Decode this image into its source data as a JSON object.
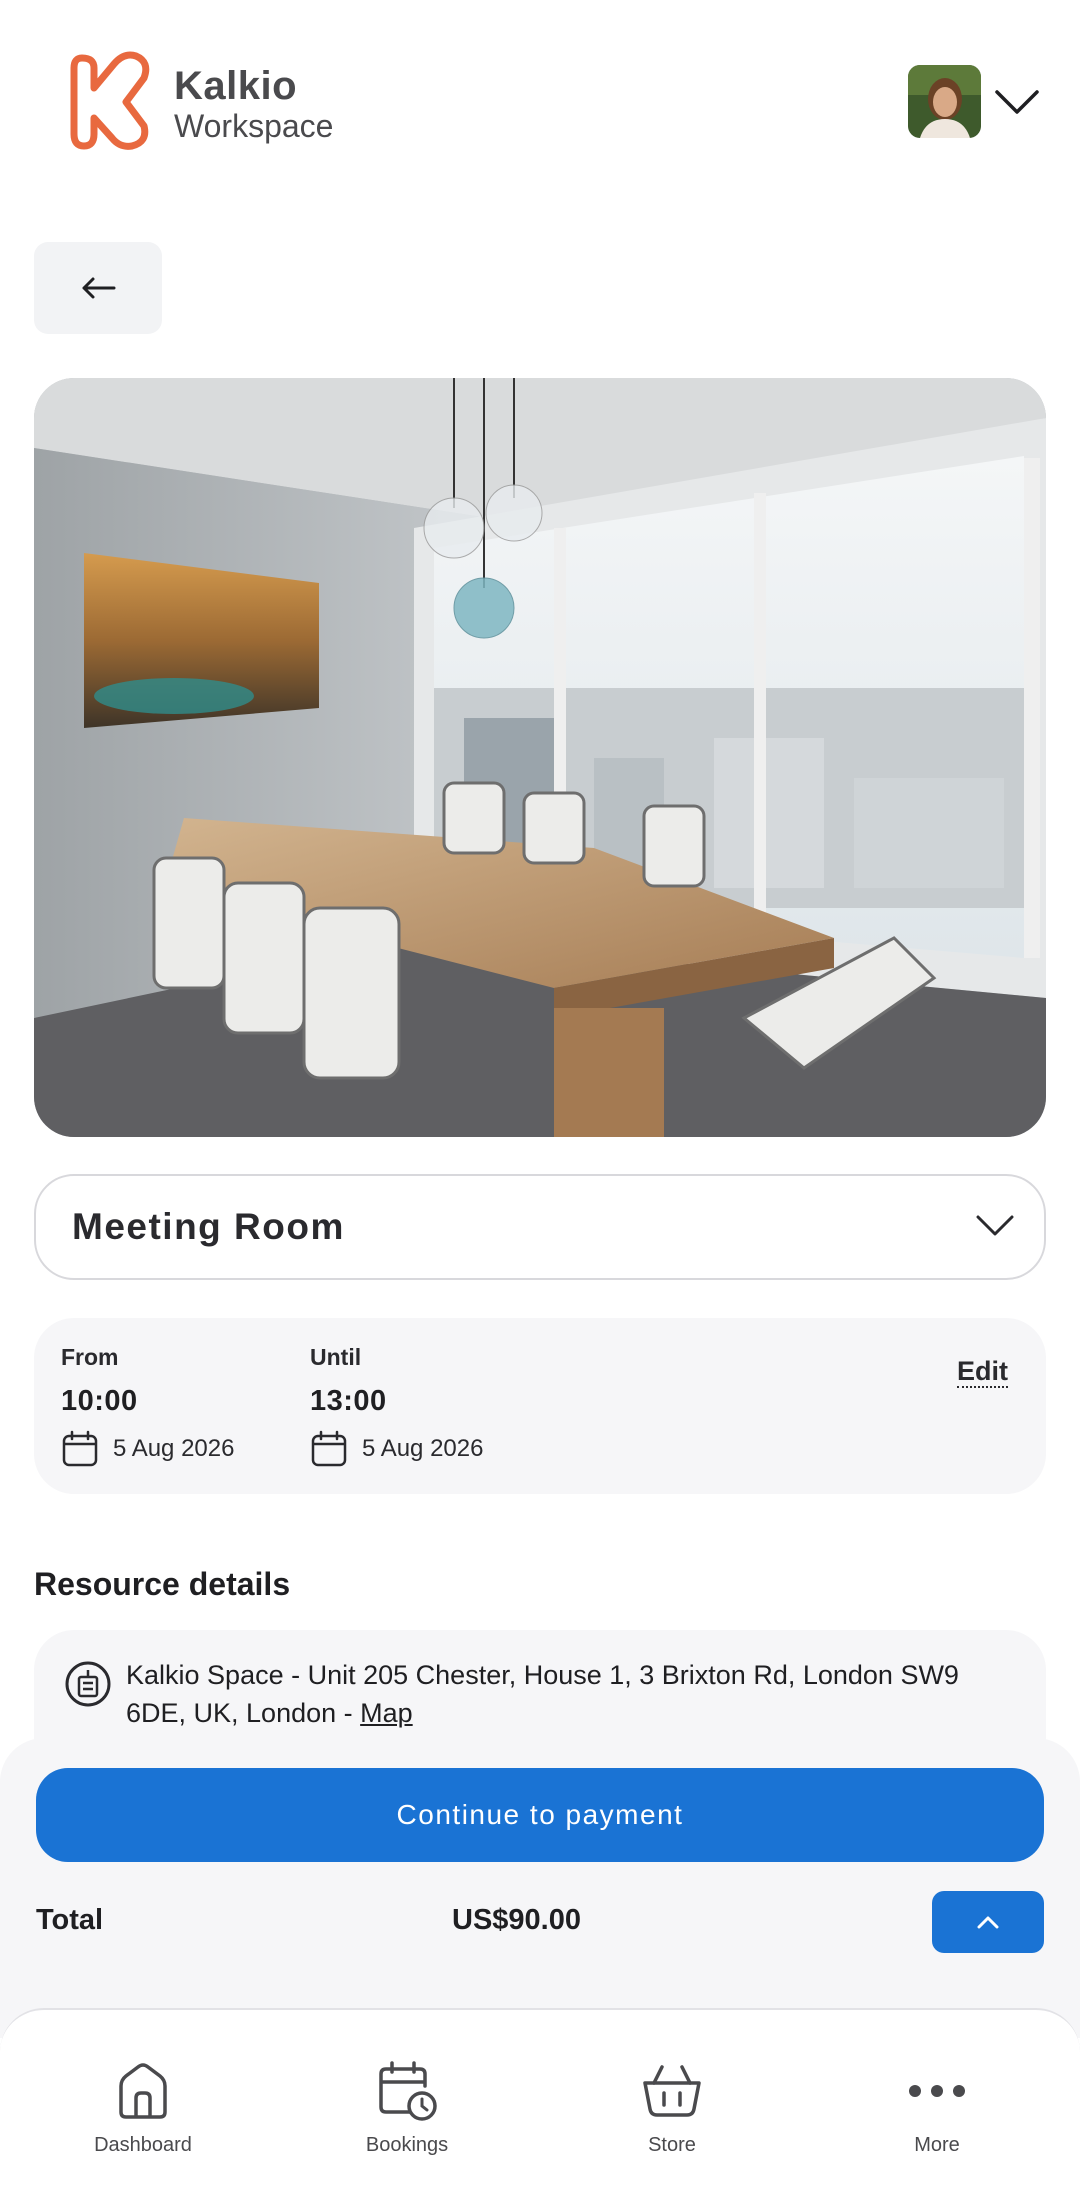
{
  "header": {
    "brand_name": "Kalkio",
    "brand_sub": "Workspace",
    "brand_color": "#e8693f"
  },
  "back_button": {
    "icon": "arrow-left-icon"
  },
  "resource": {
    "selected": "Meeting Room"
  },
  "booking": {
    "from_label": "From",
    "from_time": "10:00",
    "from_date": "5 Aug 2026",
    "until_label": "Until",
    "until_time": "13:00",
    "until_date": "5 Aug 2026",
    "edit_label": "Edit"
  },
  "details": {
    "title": "Resource details",
    "address": "Kalkio Space - Unit 205 Chester, House 1, 3 Brixton Rd, London SW9 6DE, UK, London - ",
    "map_label": "Map"
  },
  "checkout": {
    "pay_label": "Continue to payment",
    "total_label": "Total",
    "total_value": "US$90.00",
    "accent": "#1a73d4"
  },
  "nav": {
    "items": [
      {
        "label": "Dashboard",
        "icon": "home-icon"
      },
      {
        "label": "Bookings",
        "icon": "calendar-clock-icon"
      },
      {
        "label": "Store",
        "icon": "basket-icon"
      },
      {
        "label": "More",
        "icon": "more-dots-icon"
      }
    ]
  }
}
